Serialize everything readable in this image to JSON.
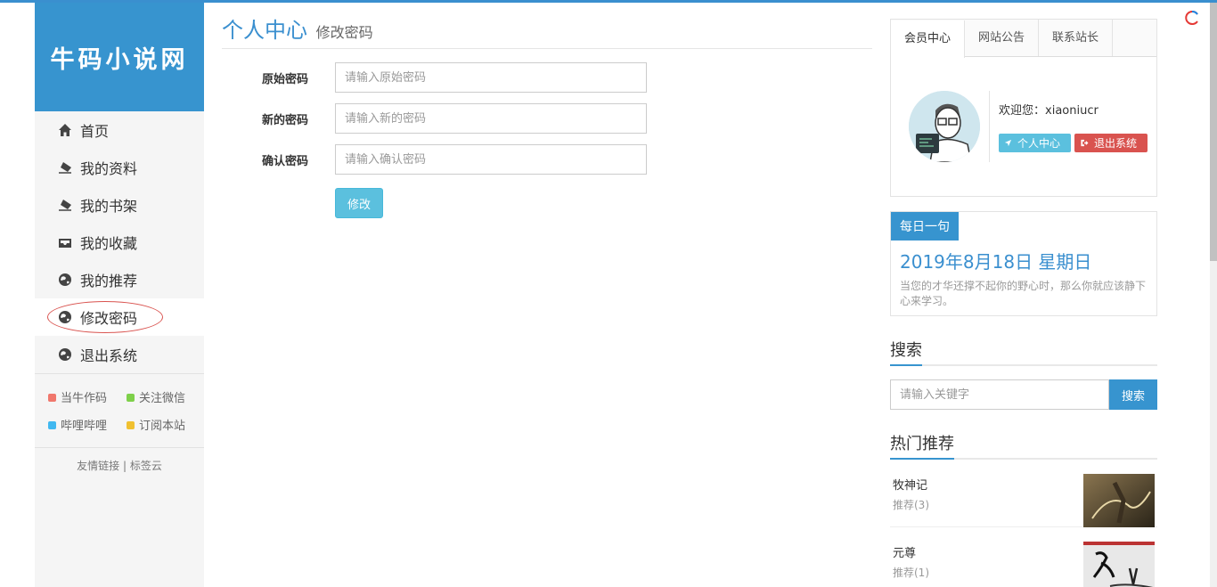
{
  "site": {
    "logo_text": "牛码小说网"
  },
  "sidebar": {
    "items": [
      {
        "label": "首页",
        "icon": "home-icon"
      },
      {
        "label": "我的资料",
        "icon": "eraser-icon"
      },
      {
        "label": "我的书架",
        "icon": "eraser-icon"
      },
      {
        "label": "我的收藏",
        "icon": "inbox-icon"
      },
      {
        "label": "我的推荐",
        "icon": "globe-icon"
      },
      {
        "label": "修改密码",
        "icon": "globe-icon",
        "active": true
      },
      {
        "label": "退出系统",
        "icon": "globe-icon"
      }
    ],
    "social": [
      {
        "label": "当牛作码",
        "color": "#f0776c"
      },
      {
        "label": "关注微信",
        "color": "#7ed04a"
      },
      {
        "label": "哔哩哔哩",
        "color": "#41b8f0"
      },
      {
        "label": "订阅本站",
        "color": "#f0c030"
      }
    ],
    "links": {
      "friend": "友情链接",
      "sep": "|",
      "tags": "标签云"
    }
  },
  "main": {
    "title": "个人中心",
    "subtitle": "修改密码",
    "fields": [
      {
        "label": "原始密码",
        "placeholder": "请输入原始密码"
      },
      {
        "label": "新的密码",
        "placeholder": "请输入新的密码"
      },
      {
        "label": "确认密码",
        "placeholder": "请输入确认密码"
      }
    ],
    "submit_label": "修改"
  },
  "right": {
    "tabs": [
      "会员中心",
      "网站公告",
      "联系站长"
    ],
    "welcome_prefix": "欢迎您：",
    "username": "xiaoniucr",
    "btn_center": "个人中心",
    "btn_logout": "退出系统",
    "daily": {
      "tag": "每日一句",
      "date": "2019年8月18日 星期日",
      "quote": "当您的才华还撑不起你的野心时，那么你就应该静下心来学习。"
    },
    "search": {
      "title": "搜索",
      "placeholder": "请输入关键字",
      "button": "搜索"
    },
    "hot": {
      "title": "热门推荐",
      "items": [
        {
          "title": "牧神记",
          "rec": "推荐(3)"
        },
        {
          "title": "元尊",
          "rec": "推荐(1)"
        }
      ]
    }
  },
  "colors": {
    "brand": "#3794cf",
    "info": "#5bc0de",
    "danger": "#d9534f"
  }
}
